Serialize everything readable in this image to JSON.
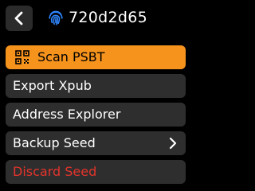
{
  "header": {
    "back_icon": "chevron-left-icon",
    "fingerprint_icon": "fingerprint-icon",
    "title": "720d2d65"
  },
  "menu": {
    "items": [
      {
        "label": "Scan PSBT",
        "icon": "qr-code-icon",
        "selected": true
      },
      {
        "label": "Export Xpub"
      },
      {
        "label": "Address Explorer"
      },
      {
        "label": "Backup Seed",
        "icon": "chevron-right-icon"
      },
      {
        "label": "Discard Seed",
        "color": "#e3342c"
      }
    ]
  },
  "colors": {
    "accent": "#f6931d",
    "button_bg": "#2e2e2e",
    "danger": "#e3342c",
    "background": "#000000"
  }
}
